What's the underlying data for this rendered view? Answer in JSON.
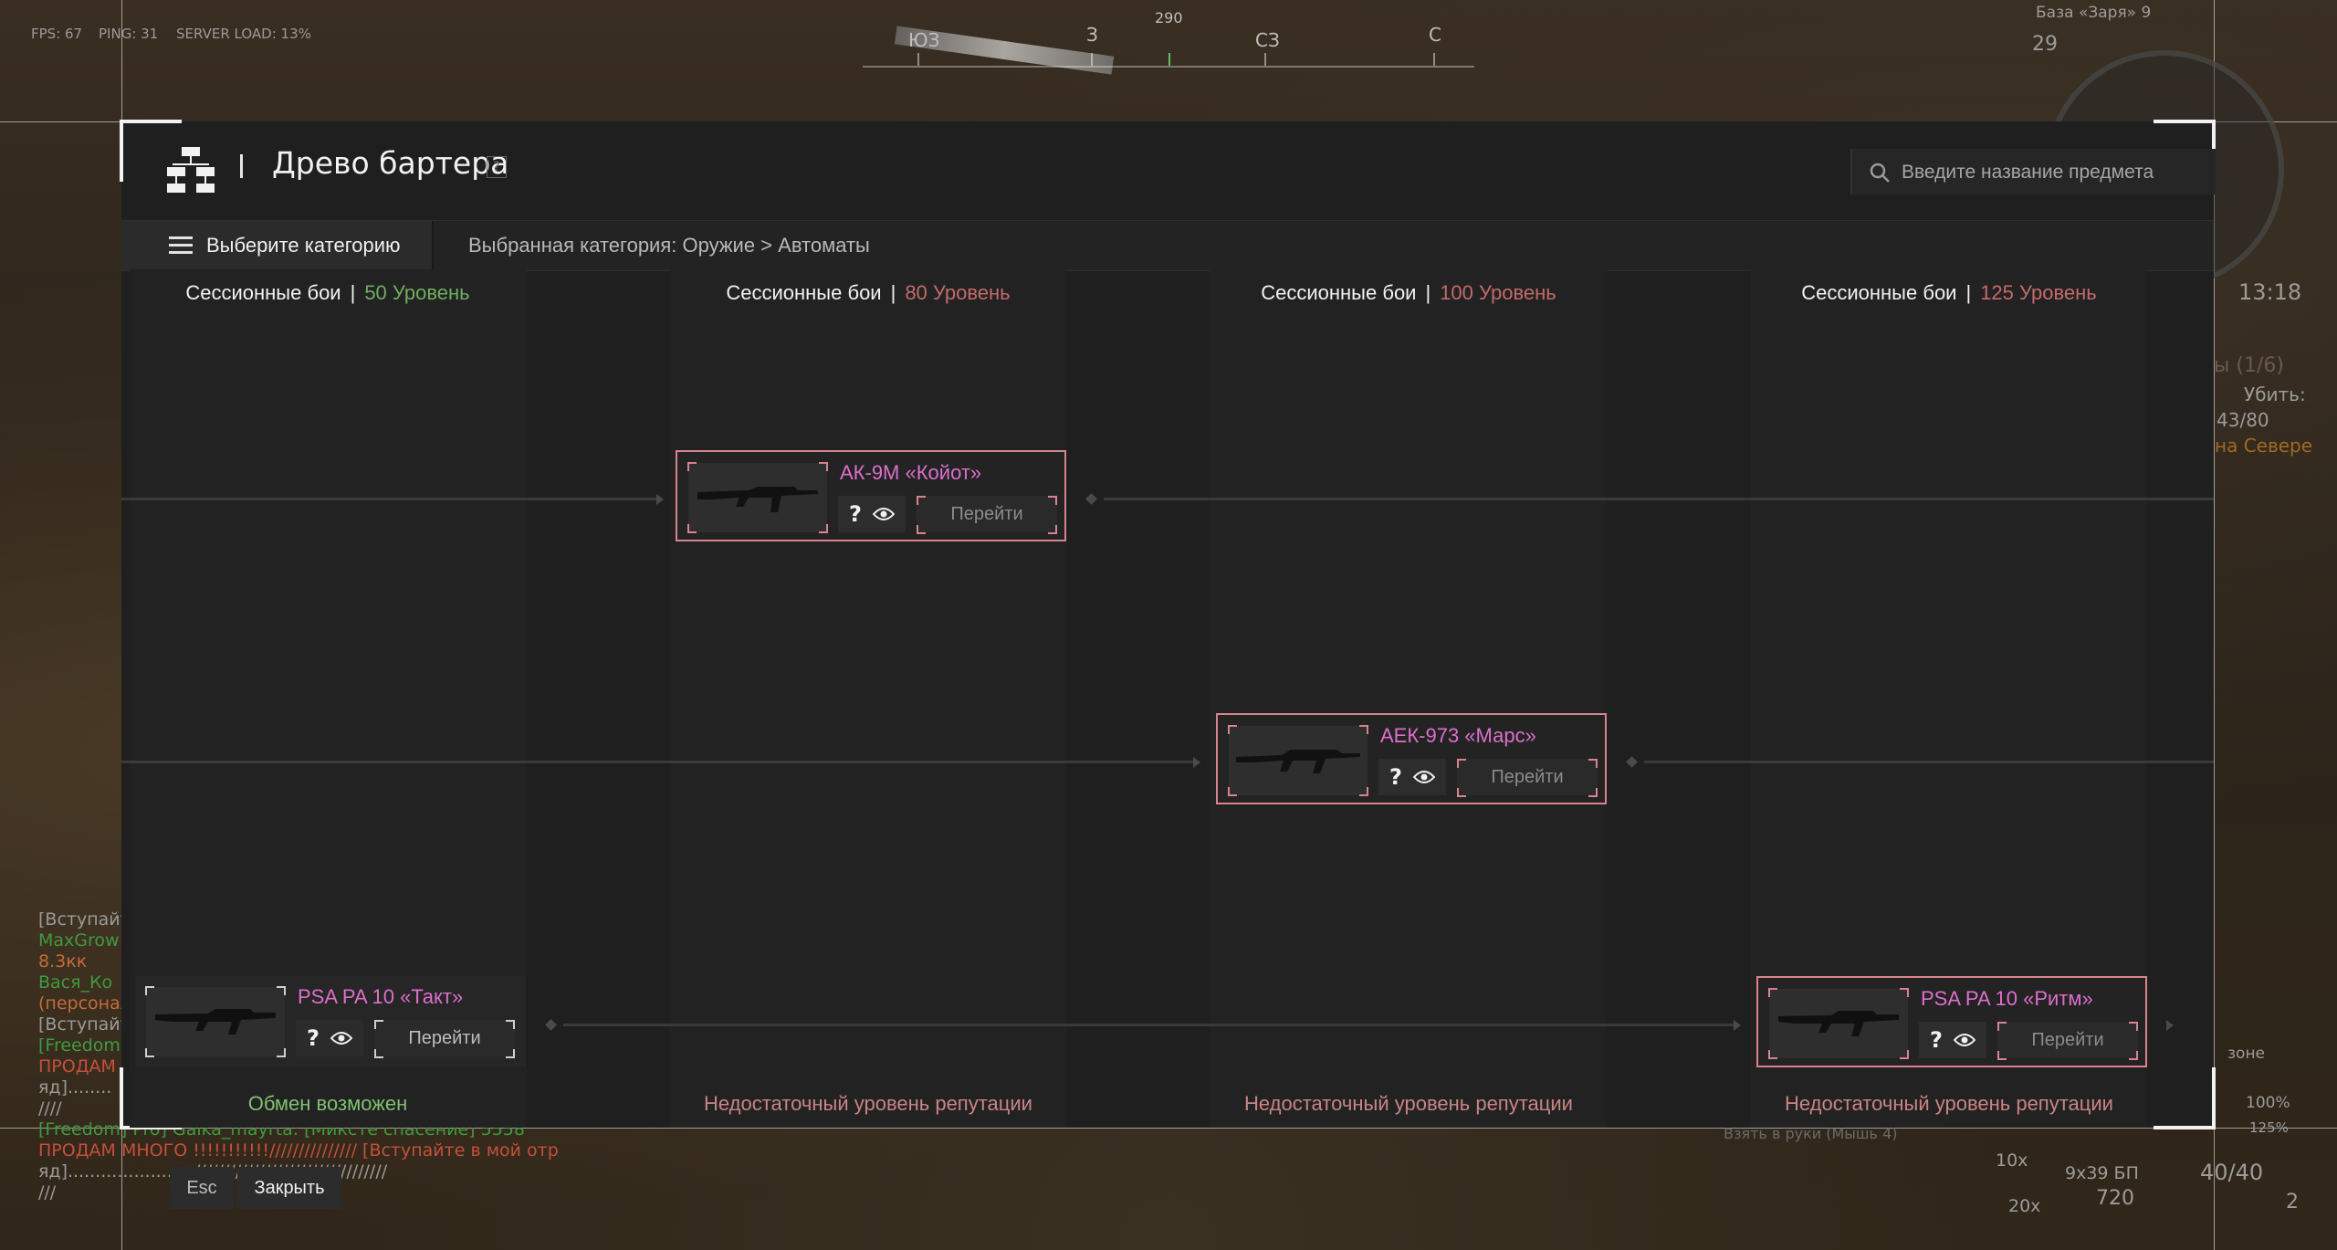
{
  "hud": {
    "fps": "FPS: 67",
    "ping": "PING: 31",
    "server_load": "SERVER LOAD: 13%",
    "compass_labels": [
      "ЮЗ",
      "З",
      "290",
      "СЗ",
      "С"
    ],
    "base_name": "База «Заря» 9",
    "base_number": "29",
    "clock": "13:18",
    "quest_progress": "ы (1/6)",
    "quest_kill": "Убить:",
    "quest_count": "43/80",
    "quest_place": "на Севере",
    "zone": "зоне",
    "percent_a": "100%",
    "percent_b": "125%",
    "hint": "Взять в руки (Мышь 4)",
    "zoom": "10x",
    "zoom_b": "20x",
    "ammo_type": "9x39 БП",
    "ammo_reserve": "720",
    "mag": "40/40",
    "grenades": "2",
    "chat": [
      "[Вступайте",
      "MaxGrow",
      "8.3кк",
      "Вася_Ко",
      "(персонал",
      "[Вступайте",
      "[Freedom",
      "ПРОДАМ",
      "яд]........",
      "////",
      "[Freedom] Pro] Gaika_mayrta: [Миксте спасение] 5558",
      "ПРОДАМ МНОГО !!!!!!!!!!!/////////////// [Вступайте в мой отр",
      "яд]......................./////////////////////////////////",
      "///"
    ]
  },
  "dialog": {
    "title": "Древо бартера",
    "help": "?",
    "search_placeholder": "Введите название предмета",
    "category_button": "Выберите категорию",
    "selected_category": "Выбранная категория: Оружие > Автоматы",
    "columns": [
      {
        "mode": "Сессионные бои",
        "level": "50 Уровень",
        "level_color": "#6fae5f",
        "footer": "Обмен возможен",
        "footer_color": "#7fc16f"
      },
      {
        "mode": "Сессионные бои",
        "level": "80 Уровень",
        "level_color": "#c46a6a",
        "footer": "Недостаточный уровень репутации",
        "footer_color": "#c98484"
      },
      {
        "mode": "Сессионные бои",
        "level": "100 Уровень",
        "level_color": "#c46a6a",
        "footer": "Недостаточный уровень репутации",
        "footer_color": "#c98484"
      },
      {
        "mode": "Сессионные бои",
        "level": "125 Уровень",
        "level_color": "#c46a6a",
        "footer": "Недостаточный уровень репутации",
        "footer_color": "#c98484"
      }
    ],
    "items": [
      {
        "name": "АК-9М «Койот»",
        "question": "?",
        "go_label": "Перейти"
      },
      {
        "name": "АЕК-973 «Марс»",
        "question": "?",
        "go_label": "Перейти"
      },
      {
        "name": "PSA PA 10 «Такт»",
        "question": "?",
        "go_label": "Перейти"
      },
      {
        "name": "PSA PA 10 «Ритм»",
        "question": "?",
        "go_label": "Перейти"
      }
    ],
    "esc_key": "Esc",
    "close_label": "Закрыть"
  }
}
